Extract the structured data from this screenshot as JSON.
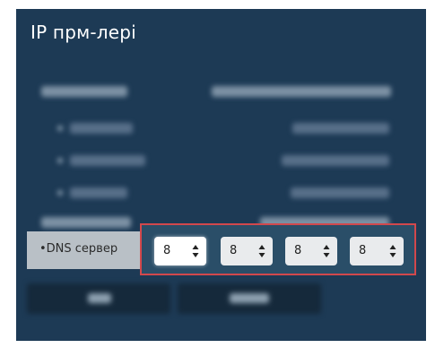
{
  "title": "IP прм-лері",
  "dns": {
    "label": "•DNS сервер",
    "octets": [
      "8",
      "8",
      "8",
      "8"
    ]
  },
  "icons": {
    "spinner": "up-down-spinner-icon"
  },
  "colors": {
    "panel": "#1d3a55",
    "highlight_border": "#d2484c",
    "label_bg": "#b9c0c6",
    "field_bg": "#e9ebed"
  }
}
